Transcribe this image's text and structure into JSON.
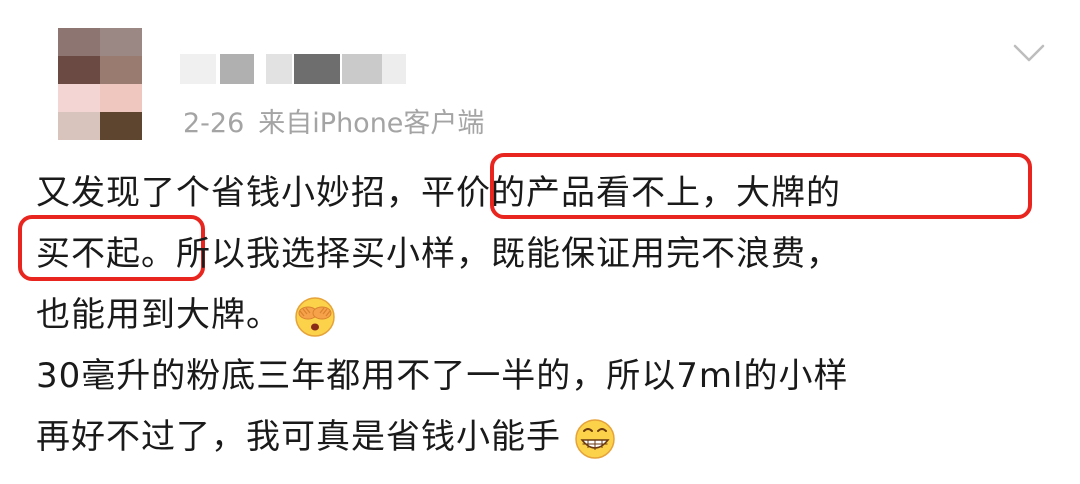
{
  "post": {
    "date": "2-26",
    "source": "来自iPhone客户端",
    "lines": [
      "又发现了个省钱小妙招，平价的产品看不上，大牌的",
      "买不起。所以我选择买小样，既能保证用完不浪费，",
      "也能用到大牌。",
      "30毫升的粉底三年都用不了一半的，所以7ml的小样",
      "再好不过了，我可真是省钱小能手"
    ]
  },
  "highlight_color": "#e8261f",
  "icons": {
    "more": "chevron-down-icon",
    "emoji_1": "face-covering-eyes-emoji",
    "emoji_2": "grinning-emoji"
  }
}
